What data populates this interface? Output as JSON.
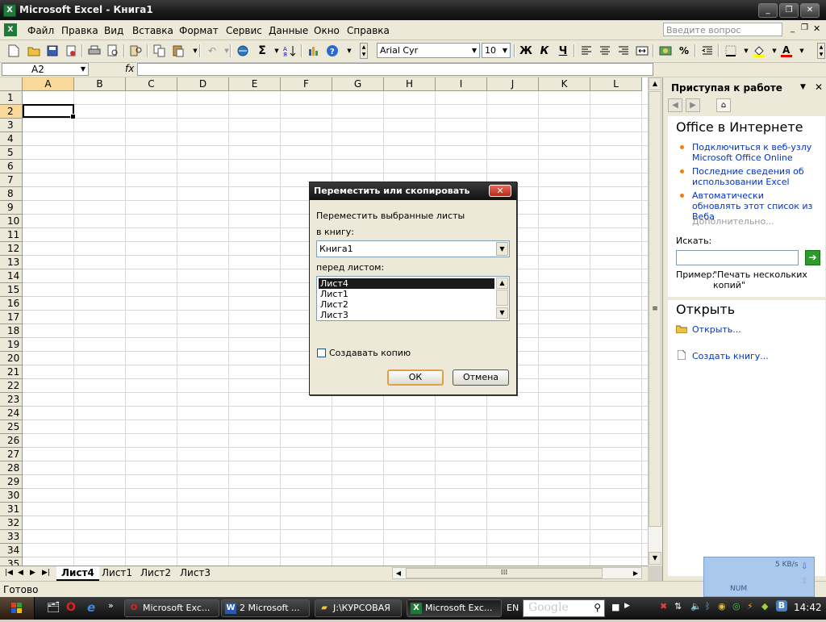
{
  "window": {
    "title": "Microsoft Excel - Книга1"
  },
  "menu": {
    "items": [
      "Файл",
      "Правка",
      "Вид",
      "Вставка",
      "Формат",
      "Сервис",
      "Данные",
      "Окно",
      "Справка"
    ],
    "ask_placeholder": "Введите вопрос"
  },
  "toolbar": {
    "font": "Arial Cyr",
    "size": "10",
    "bold": "Ж",
    "italic": "К",
    "underline": "Ч",
    "percent": "%",
    "sigma": "Σ"
  },
  "formula_bar": {
    "name_box": "A2",
    "fx": "fx",
    "value": ""
  },
  "grid": {
    "columns": [
      "A",
      "B",
      "C",
      "D",
      "E",
      "F",
      "G",
      "H",
      "I",
      "J",
      "K",
      "L"
    ],
    "rows": [
      "1",
      "2",
      "3",
      "4",
      "5",
      "6",
      "7",
      "8",
      "9",
      "10",
      "11",
      "12",
      "13",
      "14",
      "15",
      "16",
      "17",
      "18",
      "19",
      "20",
      "21",
      "22",
      "23",
      "24",
      "25",
      "26",
      "27",
      "28",
      "29",
      "30",
      "31",
      "32",
      "33",
      "34",
      "35"
    ],
    "selected_cell": "A2"
  },
  "sheet_tabs": {
    "active": "Лист4",
    "tabs": [
      "Лист4",
      "Лист1",
      "Лист2",
      "Лист3"
    ]
  },
  "status": {
    "text": "Готово",
    "num": "NUM"
  },
  "task_pane": {
    "title": "Приступая к работе",
    "section1": "Office в Интернете",
    "links": [
      "Подключиться к веб-узлу Microsoft Office Online",
      "Последние сведения об использовании Excel",
      "Автоматически обновлять этот список из Веба"
    ],
    "more": "Дополнительно...",
    "search_label": "Искать:",
    "example_label": "Пример:",
    "example_text": "\"Печать нескольких копий\"",
    "section2": "Открыть",
    "open_link": "Открыть...",
    "create_link": "Создать книгу..."
  },
  "net_monitor": {
    "speed": "5 KB/s"
  },
  "dialog": {
    "title": "Переместить или скопировать",
    "subtitle": "Переместить выбранные листы",
    "book_label": "в книгу:",
    "book_value": "Книга1",
    "before_label": "перед листом:",
    "sheets": [
      "Лист4",
      "Лист1",
      "Лист2",
      "Лист3"
    ],
    "selected_sheet": "Лист4",
    "copy_label": "Создавать копию",
    "ok": "ОК",
    "cancel": "Отмена"
  },
  "taskbar": {
    "tasks": [
      "Microsoft Exc...",
      "2 Microsoft ...",
      "J:\\КУРСОВАЯ",
      "Microsoft Exc..."
    ],
    "lang": "EN",
    "search_logo": "Google",
    "time": "14:42"
  }
}
